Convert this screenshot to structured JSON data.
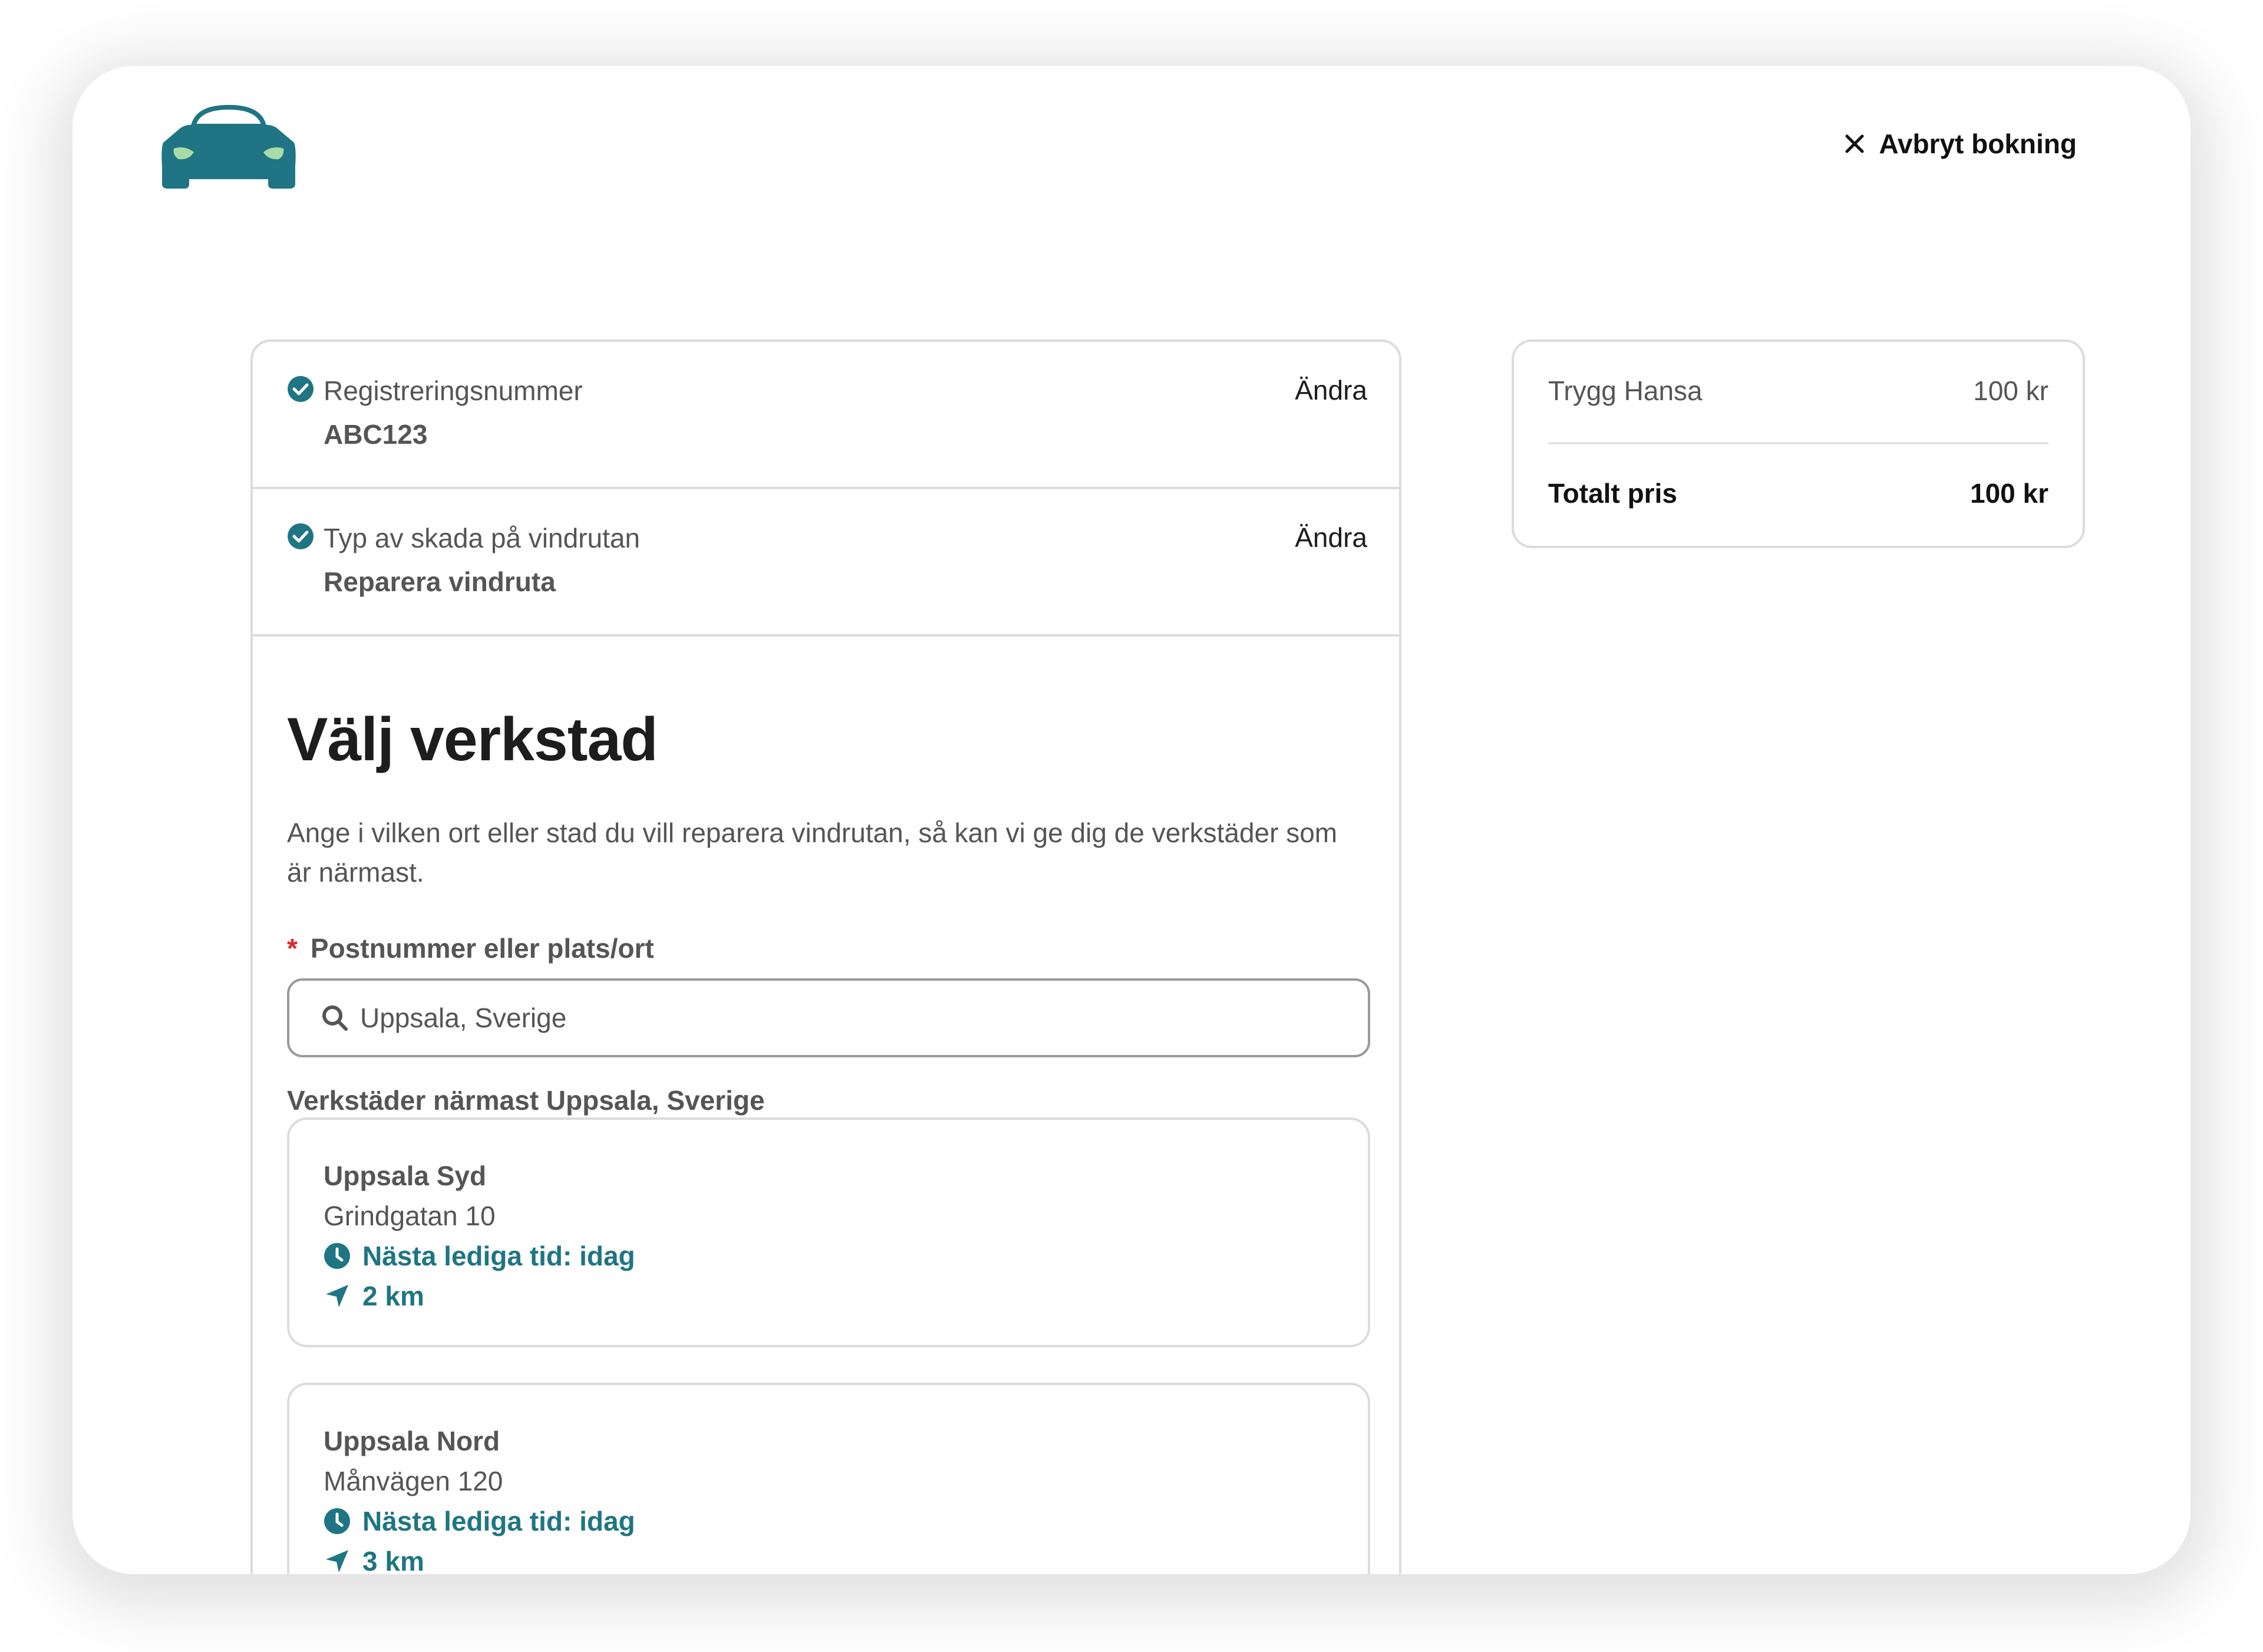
{
  "header": {
    "logo_icon": "car-icon",
    "cancel_label": "Avbryt bokning"
  },
  "steps": [
    {
      "label": "Registreringsnummer",
      "value": "ABC123",
      "edit_label": "Ändra"
    },
    {
      "label": "Typ av skada på vindrutan",
      "value": "Reparera vindruta",
      "edit_label": "Ändra"
    }
  ],
  "main": {
    "title": "Välj verkstad",
    "description": "Ange i vilken ort eller stad du vill reparera vindrutan, så kan vi ge dig de verkstäder som är närmast.",
    "field_required_mark": "*",
    "field_label": "Postnummer eller plats/ort",
    "search_value": "Uppsala, Sverige",
    "results_title": "Verkstäder närmast Uppsala, Sverige",
    "shops": [
      {
        "name": "Uppsala Syd",
        "address": "Grindgatan 10",
        "availability": "Nästa lediga tid: idag",
        "distance": "2 km"
      },
      {
        "name": "Uppsala Nord",
        "address": "Månvägen 120",
        "availability": "Nästa lediga tid: idag",
        "distance": "3 km"
      }
    ]
  },
  "summary": {
    "item_label": "Trygg Hansa",
    "item_price": "100 kr",
    "total_label": "Totalt pris",
    "total_price": "100 kr"
  },
  "colors": {
    "accent": "#1f7583",
    "required": "#e0262c",
    "border": "#dcdcdc"
  }
}
